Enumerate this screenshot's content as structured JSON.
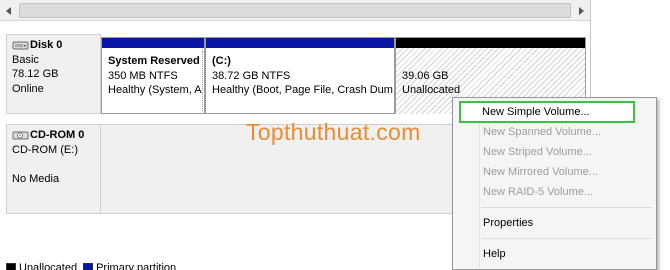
{
  "disks": [
    {
      "name": "Disk 0",
      "type": "Basic",
      "size": "78.12 GB",
      "status": "Online",
      "icon": "disk-icon",
      "partitions": [
        {
          "name": "System Reserved",
          "size": "350 MB NTFS",
          "status": "Healthy (System, A"
        },
        {
          "name": "(C:)",
          "size": "38.72 GB NTFS",
          "status": "Healthy (Boot, Page File, Crash Dum"
        },
        {
          "name": "",
          "size": "39.06 GB",
          "status": "Unallocated"
        }
      ]
    },
    {
      "name": "CD-ROM 0",
      "type": "CD-ROM (E:)",
      "status": "No Media",
      "icon": "cdrom-icon"
    }
  ],
  "watermark": "Topthuthuat.com",
  "legend": {
    "unallocated": "Unallocated",
    "primary": "Primary partition"
  },
  "context_menu": {
    "items": [
      {
        "label": "New Simple Volume...",
        "enabled": true
      },
      {
        "label": "New Spanned Volume...",
        "enabled": false
      },
      {
        "label": "New Striped Volume...",
        "enabled": false
      },
      {
        "label": "New Mirrored Volume...",
        "enabled": false
      },
      {
        "label": "New RAID-5 Volume...",
        "enabled": false
      },
      {
        "label": "Properties",
        "enabled": true
      },
      {
        "label": "Help",
        "enabled": true
      }
    ]
  },
  "colors": {
    "primary_partition": "#0b16a6",
    "unallocated": "#000000",
    "highlight_outline": "#3cc042",
    "watermark": "#ee8b2d"
  }
}
